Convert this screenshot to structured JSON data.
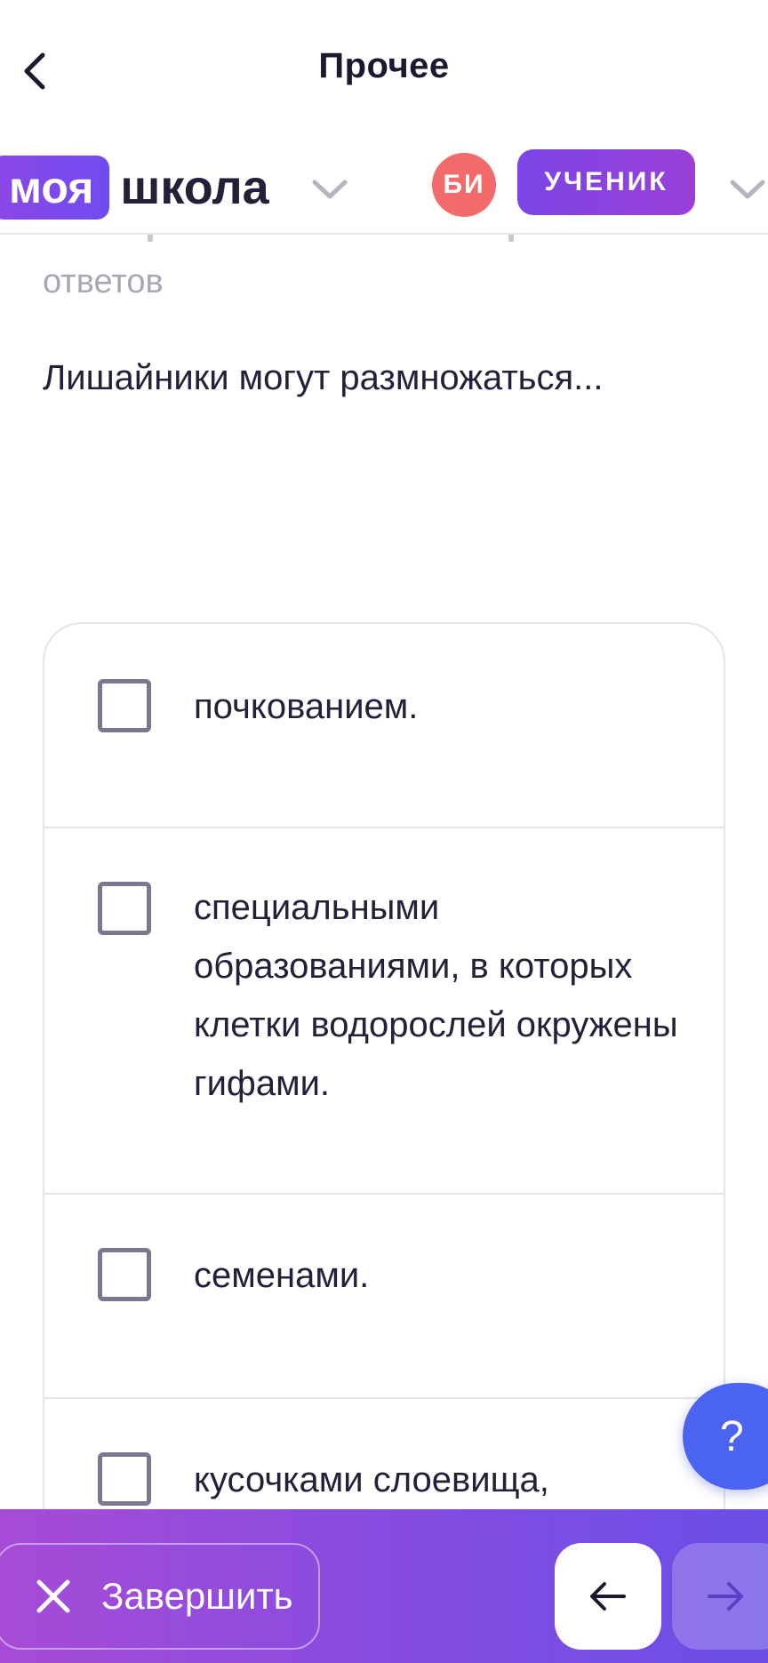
{
  "header": {
    "title": "Прочее",
    "back_icon": "chevron-left-icon"
  },
  "brand": {
    "logo_part1": "моя",
    "logo_part2": "школа",
    "avatar_initials": "БИ",
    "role": "УЧЕНИК",
    "colors": {
      "accent": "#7c45e6",
      "avatar": "#f36a6a",
      "help": "#4a63f0"
    }
  },
  "content": {
    "hint": "ответов",
    "question": "Лишайники могут размножаться...",
    "answers": [
      {
        "text": "почкованием.",
        "checked": false
      },
      {
        "text": "специальными образованиями, в которых клетки водорослей окружены гифами.",
        "checked": false
      },
      {
        "text": "семенами.",
        "checked": false
      },
      {
        "text": "кусочками слоевища,",
        "checked": false
      }
    ]
  },
  "help": {
    "label": "?"
  },
  "footer": {
    "finish_label": "Завершить",
    "prev_icon": "arrow-left-icon",
    "next_icon": "arrow-right-icon"
  }
}
